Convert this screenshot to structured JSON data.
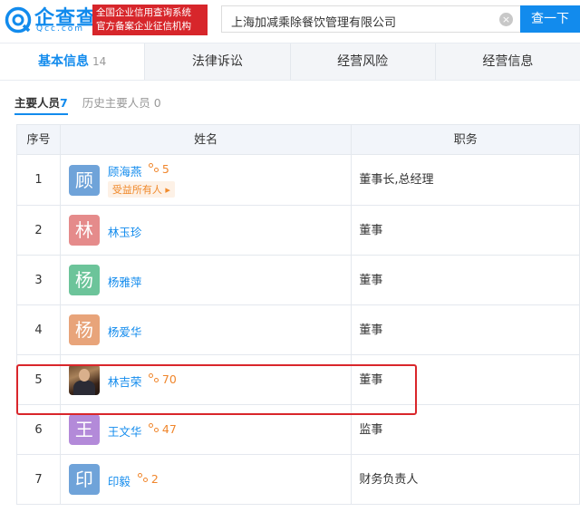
{
  "header": {
    "logo_text": "企查查",
    "logo_sub": "Qcc.com",
    "slogan_line1": "全国企业信用查询系统",
    "slogan_line2": "官方备案企业征信机构",
    "search_value": "上海加减乘除餐饮管理有限公司",
    "search_button": "查一下"
  },
  "tabs": [
    {
      "label": "基本信息",
      "count": "14"
    },
    {
      "label": "法律诉讼"
    },
    {
      "label": "经营风险"
    },
    {
      "label": "经营信息"
    }
  ],
  "subtabs": {
    "main_label": "主要人员",
    "main_count": "7",
    "history_label": "历史主要人员",
    "history_count": "0"
  },
  "table": {
    "headers": [
      "序号",
      "姓名",
      "职务"
    ],
    "rows": [
      {
        "index": "1",
        "avatar_char": "顾",
        "avatar_color": "#6fa3d9",
        "name": "顾海燕",
        "relations": "5",
        "badge": "受益所有人",
        "role": "董事长,总经理"
      },
      {
        "index": "2",
        "avatar_char": "林",
        "avatar_color": "#e58b8b",
        "name": "林玉珍",
        "role": "董事"
      },
      {
        "index": "3",
        "avatar_char": "杨",
        "avatar_color": "#6cc49a",
        "name": "杨雅萍",
        "role": "董事"
      },
      {
        "index": "4",
        "avatar_char": "杨",
        "avatar_color": "#e8a47a",
        "name": "杨爱华",
        "role": "董事"
      },
      {
        "index": "5",
        "avatar_char": "",
        "avatar_color": "",
        "name": "林吉荣",
        "relations": "70",
        "role": "董事"
      },
      {
        "index": "6",
        "avatar_char": "王",
        "avatar_color": "#b38ad9",
        "name": "王文华",
        "relations": "47",
        "role": "监事"
      },
      {
        "index": "7",
        "avatar_char": "印",
        "avatar_color": "#6fa3d9",
        "name": "印毅",
        "relations": "2",
        "role": "财务负责人"
      }
    ]
  },
  "colors": {
    "brand": "#128bed",
    "highlight": "#d9262b",
    "relation": "#f0862c"
  }
}
